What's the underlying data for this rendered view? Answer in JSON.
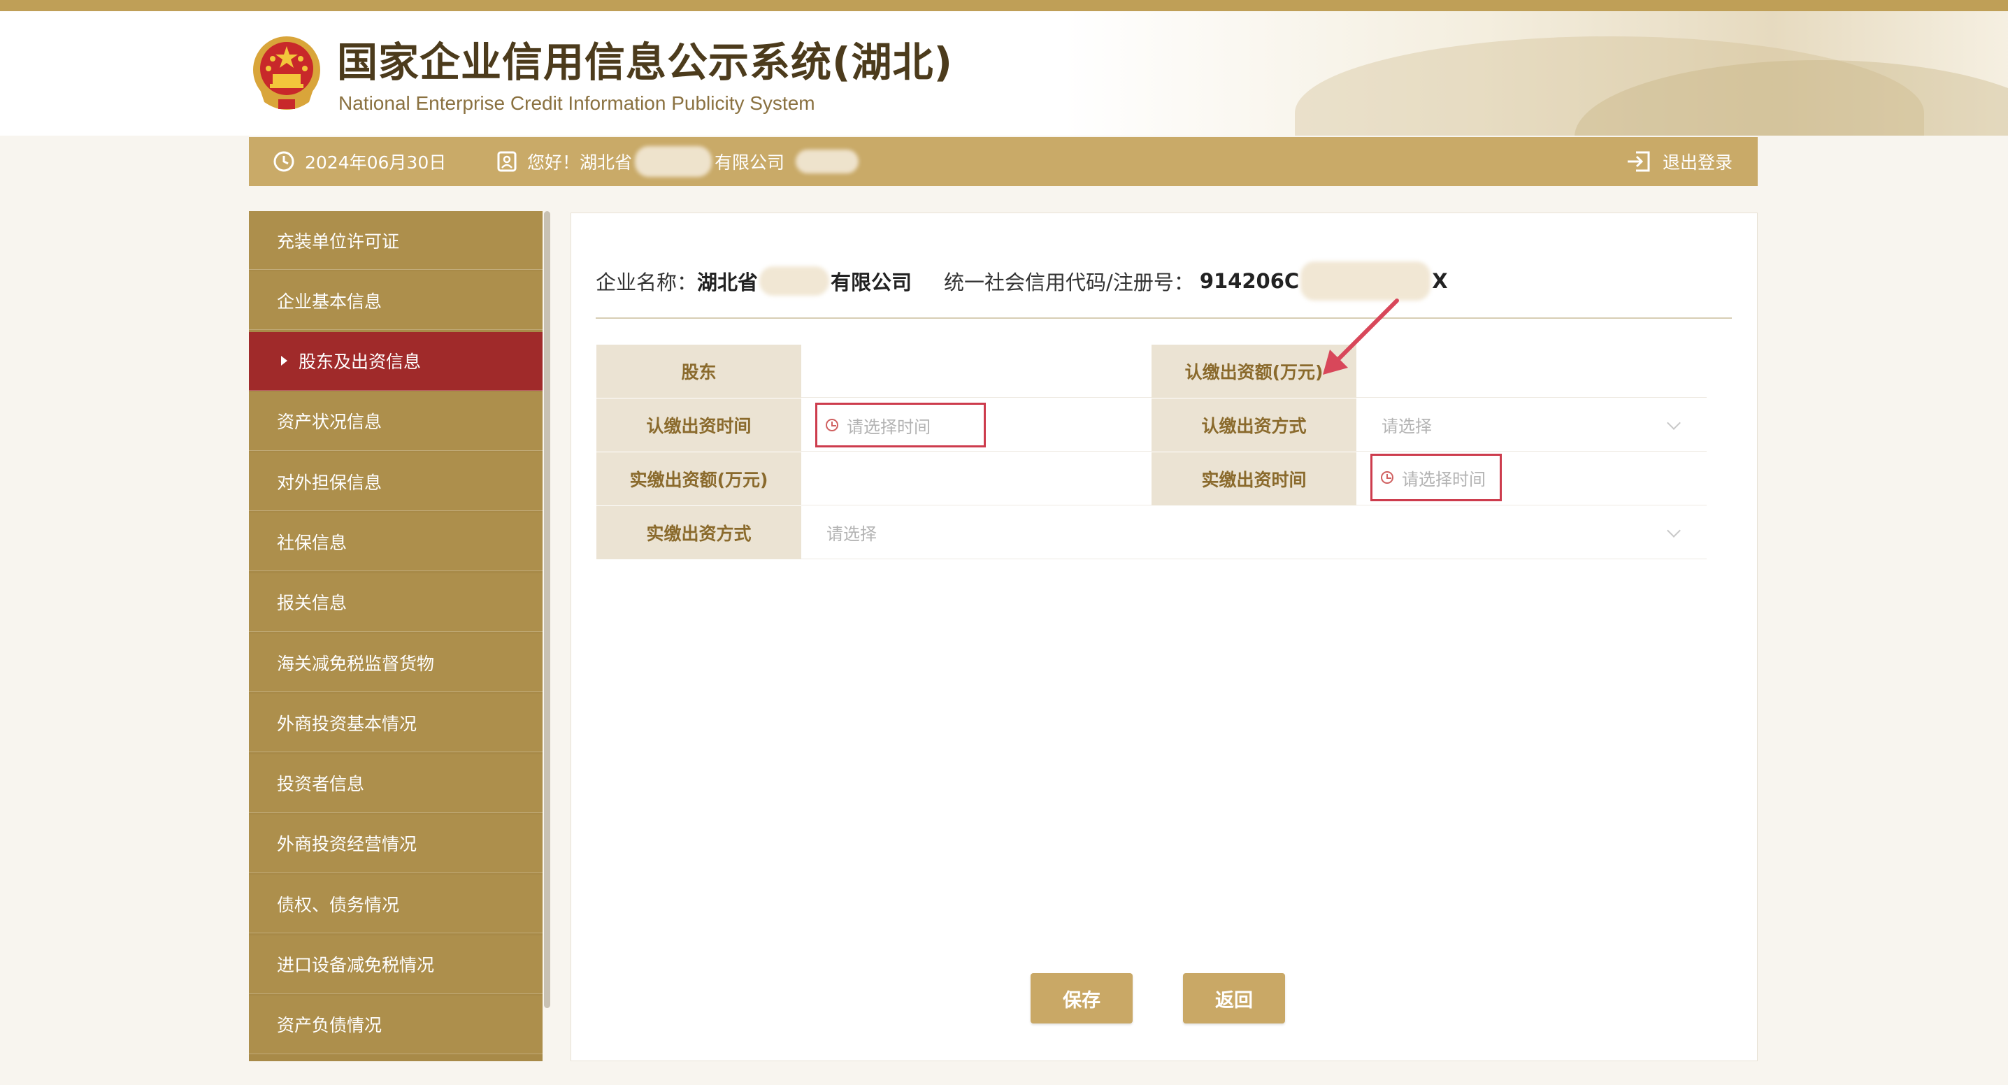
{
  "header": {
    "title": "国家企业信用信息公示系统(湖北)",
    "subtitle": "National Enterprise Credit Information Publicity System"
  },
  "infobar": {
    "date": "2024年06月30日",
    "greeting_prefix": "您好！湖北省",
    "greeting_suffix": "有限公司",
    "logout": "退出登录"
  },
  "sidebar": {
    "items": [
      {
        "label": "充装单位许可证",
        "active": false
      },
      {
        "label": "企业基本信息",
        "active": false
      },
      {
        "label": "股东及出资信息",
        "active": true
      },
      {
        "label": "资产状况信息",
        "active": false
      },
      {
        "label": "对外担保信息",
        "active": false
      },
      {
        "label": "社保信息",
        "active": false
      },
      {
        "label": "报关信息",
        "active": false
      },
      {
        "label": "海关减免税监督货物",
        "active": false
      },
      {
        "label": "外商投资基本情况",
        "active": false
      },
      {
        "label": "投资者信息",
        "active": false
      },
      {
        "label": "外商投资经营情况",
        "active": false
      },
      {
        "label": "债权、债务情况",
        "active": false
      },
      {
        "label": "进口设备减免税情况",
        "active": false
      },
      {
        "label": "资产负债情况",
        "active": false
      }
    ]
  },
  "company": {
    "name_label": "企业名称：",
    "name_prefix": "湖北省",
    "name_suffix": "有限公司",
    "code_label": "统一社会信用代码/注册号：",
    "code_prefix": "914206C",
    "code_suffix": "X"
  },
  "form": {
    "shareholder_label": "股东",
    "subscribed_amount_label": "认缴出资额(万元)",
    "subscribed_time_label": "认缴出资时间",
    "subscribed_time_placeholder": "请选择时间",
    "subscribed_method_label": "认缴出资方式",
    "subscribed_method_placeholder": "请选择",
    "paid_amount_label": "实缴出资额(万元)",
    "paid_time_label": "实缴出资时间",
    "paid_time_placeholder": "请选择时间",
    "paid_method_label": "实缴出资方式",
    "paid_method_placeholder": "请选择"
  },
  "buttons": {
    "save": "保存",
    "back": "返回"
  },
  "colors": {
    "gold": "#c9aa68",
    "sidebar": "#ad8f4c",
    "active": "#a02a2a",
    "highlight": "#cd3c4d"
  }
}
